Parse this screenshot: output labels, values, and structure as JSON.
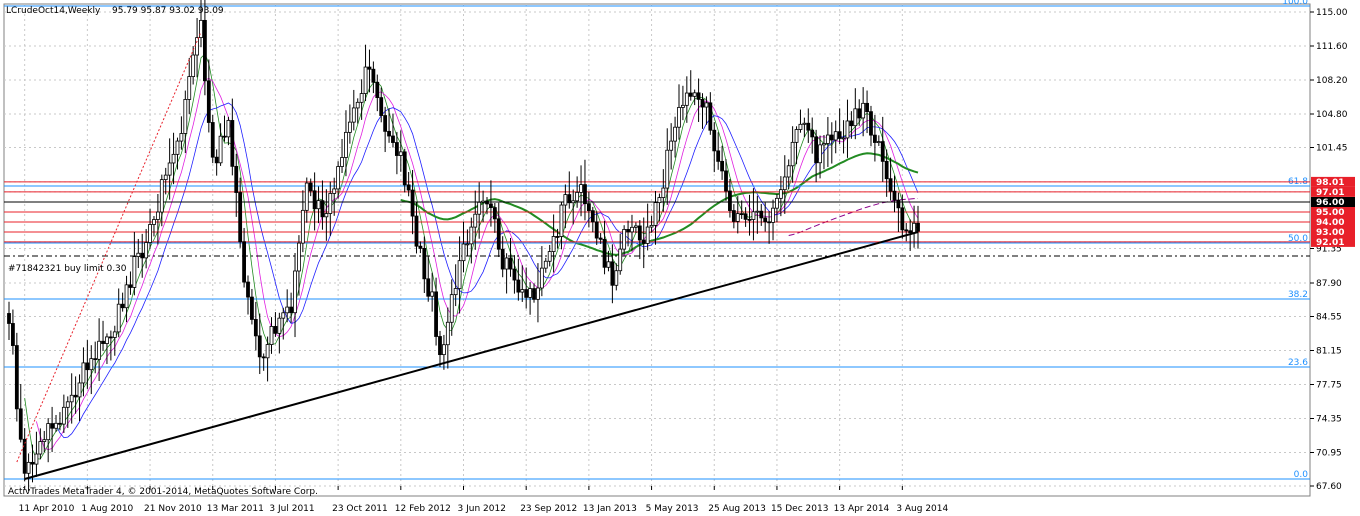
{
  "header": {
    "symbol_label": "LCrudeOct14,Weekly",
    "ohlc": "95.79 95.87 93.02 93.09"
  },
  "footer": {
    "copyright": "ActivTrades MetaTrader 4, © 2001-2014, MetaQuotes Software Corp."
  },
  "order": {
    "label": "#71842321 buy limit 0.30",
    "price": 90.6
  },
  "colors": {
    "candle": "#000000",
    "fib": "#1e90ff",
    "red_level": "#e8202a",
    "grid": "#c8c8c8",
    "trend": "#000000",
    "ma_green": "#228b22",
    "ma_blue": "#2020ff",
    "ma_magenta": "#e020e0",
    "ma_purple": "#8b008b",
    "current_price_bg": "#000000"
  },
  "chart_data": {
    "type": "candlestick",
    "timeframe": "Weekly",
    "ylim": [
      67.6,
      115.8
    ],
    "y_ticks": [
      "115.00",
      "111.60",
      "108.20",
      "104.80",
      "101.45",
      "98.01",
      "97.01",
      "96.00",
      "95.00",
      "94.00",
      "93.00",
      "92.01",
      "91.35",
      "87.90",
      "84.55",
      "81.15",
      "77.75",
      "74.35",
      "70.95",
      "67.60"
    ],
    "x_tick_labels": [
      "11 Apr 2010",
      "1 Aug 2010",
      "21 Nov 2010",
      "13 Mar 2011",
      "3 Jul 2011",
      "23 Oct 2011",
      "12 Feb 2012",
      "3 Jun 2012",
      "23 Sep 2012",
      "13 Jan 2013",
      "5 May 2013",
      "25 Aug 2013",
      "15 Dec 2013",
      "13 Apr 2014",
      "3 Aug 2014"
    ],
    "fibonacci": [
      {
        "level": "100.0",
        "price": 115.6
      },
      {
        "level": "61.8",
        "price": 97.6
      },
      {
        "level": "50.0",
        "price": 91.9
      },
      {
        "level": "38.2",
        "price": 86.3
      },
      {
        "level": "23.6",
        "price": 79.5
      },
      {
        "level": "0.0",
        "price": 68.3
      }
    ],
    "price_levels": [
      {
        "label": "98.01",
        "price": 98.01,
        "color": "red"
      },
      {
        "label": "97.01",
        "price": 97.01,
        "color": "red"
      },
      {
        "label": "96.00",
        "price": 96.0,
        "color": "black"
      },
      {
        "label": "95.00",
        "price": 95.0,
        "color": "red"
      },
      {
        "label": "94.00",
        "price": 94.0,
        "color": "red"
      },
      {
        "label": "93.00",
        "price": 93.0,
        "color": "red"
      },
      {
        "label": "92.01",
        "price": 92.01,
        "color": "red"
      }
    ],
    "current_price": 93.09,
    "trendline": {
      "from": {
        "index": 4,
        "price": 68.3
      },
      "to": {
        "index": 232,
        "price": 93.0
      }
    },
    "candles_count": 233,
    "anchors": [
      [
        0,
        84.5
      ],
      [
        4,
        68.3
      ],
      [
        9,
        72.2
      ],
      [
        14,
        75.5
      ],
      [
        20,
        79.5
      ],
      [
        25,
        82.0
      ],
      [
        30,
        87.5
      ],
      [
        36,
        93.5
      ],
      [
        44,
        104.0
      ],
      [
        49,
        113.5
      ],
      [
        52,
        100.0
      ],
      [
        56,
        103.5
      ],
      [
        60,
        89.0
      ],
      [
        64,
        80.0
      ],
      [
        68,
        84.0
      ],
      [
        72,
        86.0
      ],
      [
        76,
        98.5
      ],
      [
        80,
        94.0
      ],
      [
        85,
        101.0
      ],
      [
        92,
        110.0
      ],
      [
        96,
        104.0
      ],
      [
        100,
        101.0
      ],
      [
        104,
        92.0
      ],
      [
        108,
        86.0
      ],
      [
        110,
        80.0
      ],
      [
        114,
        88.0
      ],
      [
        118,
        94.0
      ],
      [
        122,
        97.0
      ],
      [
        126,
        90.0
      ],
      [
        130,
        87.0
      ],
      [
        134,
        86.0
      ],
      [
        138,
        91.0
      ],
      [
        142,
        96.0
      ],
      [
        146,
        97.0
      ],
      [
        150,
        93.0
      ],
      [
        154,
        88.0
      ],
      [
        158,
        94.0
      ],
      [
        162,
        93.0
      ],
      [
        166,
        96.0
      ],
      [
        170,
        104.0
      ],
      [
        174,
        107.0
      ],
      [
        178,
        105.0
      ],
      [
        182,
        98.0
      ],
      [
        186,
        94.0
      ],
      [
        190,
        95.0
      ],
      [
        194,
        94.0
      ],
      [
        198,
        98.0
      ],
      [
        202,
        104.0
      ],
      [
        206,
        101.0
      ],
      [
        210,
        102.0
      ],
      [
        214,
        104.0
      ],
      [
        218,
        106.0
      ],
      [
        222,
        101.0
      ],
      [
        226,
        96.0
      ],
      [
        229,
        93.5
      ],
      [
        232,
        93.1
      ]
    ]
  }
}
